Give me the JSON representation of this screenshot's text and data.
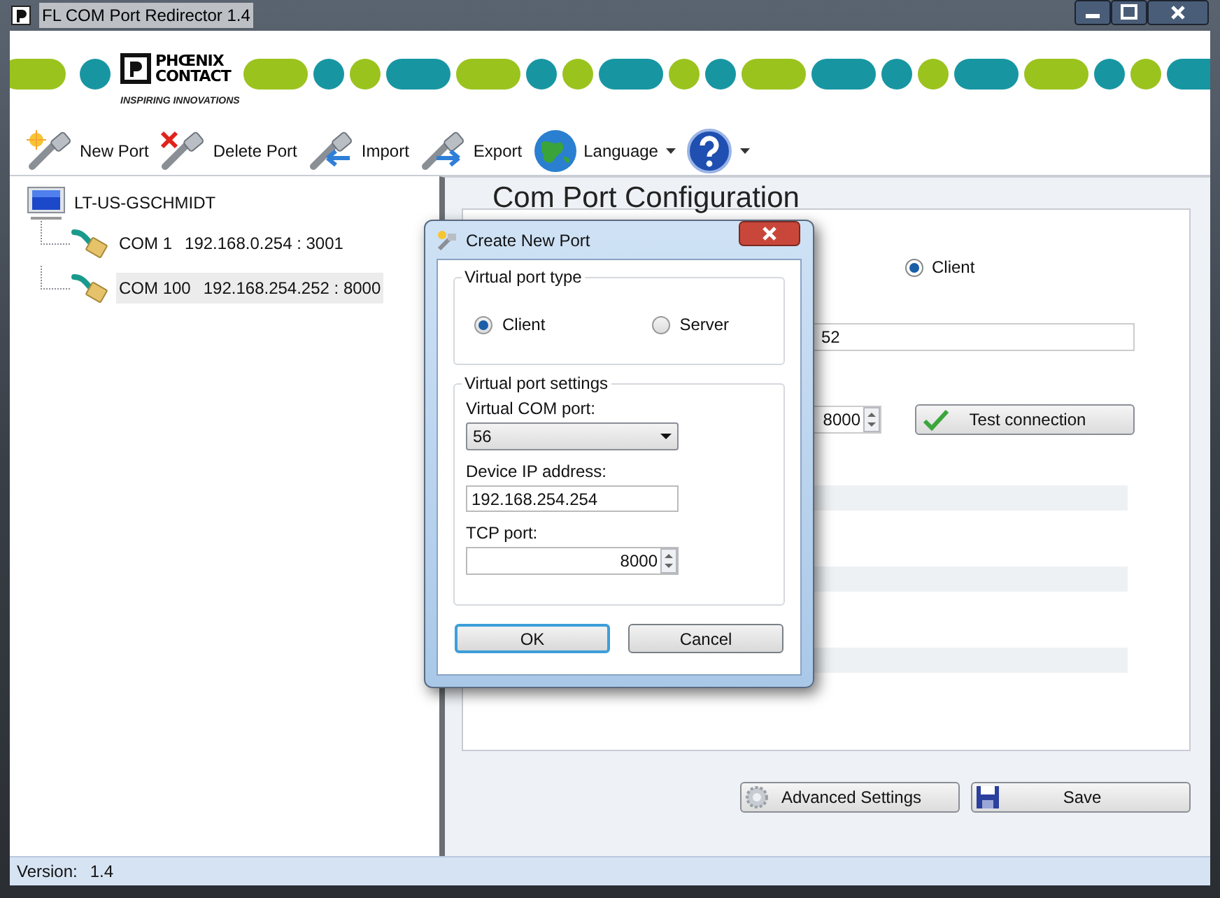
{
  "window": {
    "title": "FL COM Port Redirector 1.4"
  },
  "banner": {
    "logo_lines": [
      "PHŒNIX",
      "CONTACT"
    ],
    "tagline": "INSPIRING INNOVATIONS"
  },
  "toolbar": [
    {
      "kind": "new",
      "label": "New Port"
    },
    {
      "kind": "delete",
      "label": "Delete Port"
    },
    {
      "kind": "import",
      "label": "Import"
    },
    {
      "kind": "export",
      "label": "Export"
    },
    {
      "kind": "language",
      "label": "Language",
      "dropdown": true
    },
    {
      "kind": "help",
      "dropdown": true
    }
  ],
  "tree": {
    "label": "LT-US-GSCHMIDT",
    "children": [
      {
        "label": "COM 1",
        "address": "192.168.0.254 : 3001",
        "selected": false
      },
      {
        "label": "COM 100",
        "address": "192.168.254.252 : 8000",
        "selected": true
      }
    ]
  },
  "config": {
    "heading": "Com Port Configuration",
    "client_option": {
      "label": "Client",
      "selected": true
    },
    "address_value": "52",
    "port_value": "8000",
    "test_button": "Test connection",
    "buttons": [
      {
        "kind": "advanced",
        "label": "Advanced Settings"
      },
      {
        "kind": "save",
        "label": "Save"
      }
    ]
  },
  "dialog": {
    "title": "Create New Port",
    "port_type": {
      "legend": "Virtual port type",
      "options": [
        {
          "label": "Client",
          "selected": true
        },
        {
          "label": "Server",
          "selected": false
        }
      ]
    },
    "settings": {
      "legend": "Virtual port settings",
      "com_port": {
        "label": "Virtual COM port:",
        "value": "56"
      },
      "ip": {
        "label": "Device IP address:",
        "value": "192.168.254.254"
      },
      "tcp": {
        "label": "TCP port:",
        "value": "8000"
      }
    },
    "buttons": [
      {
        "label": "OK",
        "default": true
      },
      {
        "label": "Cancel",
        "default": false
      }
    ]
  },
  "status_bar": {
    "label": "Version:",
    "value": "1.4"
  }
}
